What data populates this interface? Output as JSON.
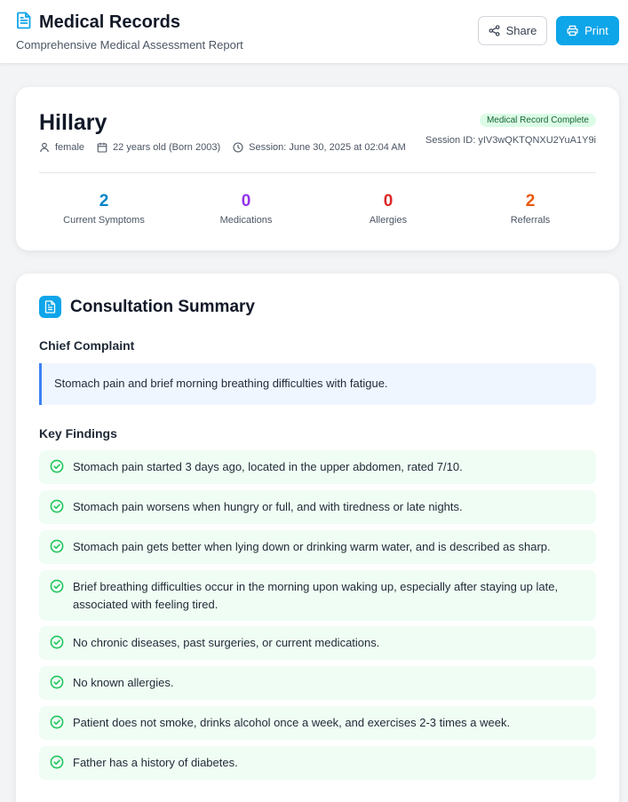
{
  "header": {
    "title": "Medical Records",
    "subtitle": "Comprehensive Medical Assessment Report",
    "share_label": "Share",
    "print_label": "Print"
  },
  "patient": {
    "name": "Hillary",
    "gender": "female",
    "age": "22 years old (Born 2003)",
    "session": "Session: June 30, 2025 at 02:04 AM",
    "status_badge": "Medical Record Complete",
    "session_id": "Session ID: yIV3wQKTQNXU2YuA1Y9i",
    "stats": [
      {
        "value": "2",
        "label": "Current Symptoms",
        "color": "#0284c7"
      },
      {
        "value": "0",
        "label": "Medications",
        "color": "#9333ea"
      },
      {
        "value": "0",
        "label": "Allergies",
        "color": "#dc2626"
      },
      {
        "value": "2",
        "label": "Referrals",
        "color": "#ea580c"
      }
    ]
  },
  "summary": {
    "title": "Consultation Summary",
    "chief_complaint_heading": "Chief Complaint",
    "chief_complaint": "Stomach pain and brief morning breathing difficulties with fatigue.",
    "key_findings_heading": "Key Findings",
    "findings": [
      "Stomach pain started 3 days ago, located in the upper abdomen, rated 7/10.",
      "Stomach pain worsens when hungry or full, and with tiredness or late nights.",
      "Stomach pain gets better when lying down or drinking warm water, and is described as sharp.",
      "Brief breathing difficulties occur in the morning upon waking up, especially after staying up late, associated with feeling tired.",
      "No chronic diseases, past surgeries, or current medications.",
      "No known allergies.",
      "Patient does not smoke, drinks alcohol once a week, and exercises 2-3 times a week.",
      "Father has a history of diabetes."
    ]
  },
  "colors": {
    "accent": "#0ea5e9",
    "success": "#22c55e"
  }
}
